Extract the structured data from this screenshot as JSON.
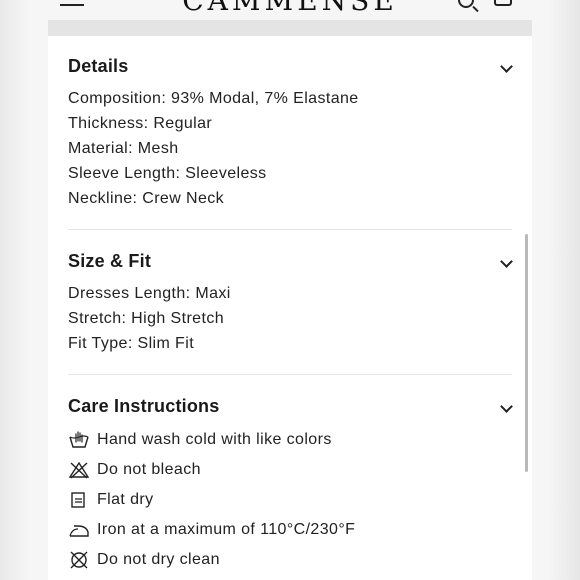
{
  "header": {
    "brand": "CAMMENSE"
  },
  "sections": {
    "details": {
      "title": "Details",
      "lines": [
        "Composition: 93% Modal, 7% Elastane",
        "Thickness: Regular",
        "Material: Mesh",
        "Sleeve Length: Sleeveless",
        "Neckline: Crew Neck"
      ]
    },
    "size_fit": {
      "title": "Size & Fit",
      "lines": [
        "Dresses Length: Maxi",
        "Stretch: High Stretch",
        "Fit Type: Slim Fit"
      ]
    },
    "care": {
      "title": "Care Instructions",
      "items": [
        {
          "icon": "hand-wash-icon",
          "text": "Hand wash cold with like colors"
        },
        {
          "icon": "do-not-bleach-icon",
          "text": "Do not bleach"
        },
        {
          "icon": "flat-dry-icon",
          "text": "Flat dry"
        },
        {
          "icon": "iron-icon",
          "text": "Iron at a maximum of 110°C/230°F"
        },
        {
          "icon": "do-not-dry-clean-icon",
          "text": "Do not dry clean"
        }
      ]
    }
  }
}
